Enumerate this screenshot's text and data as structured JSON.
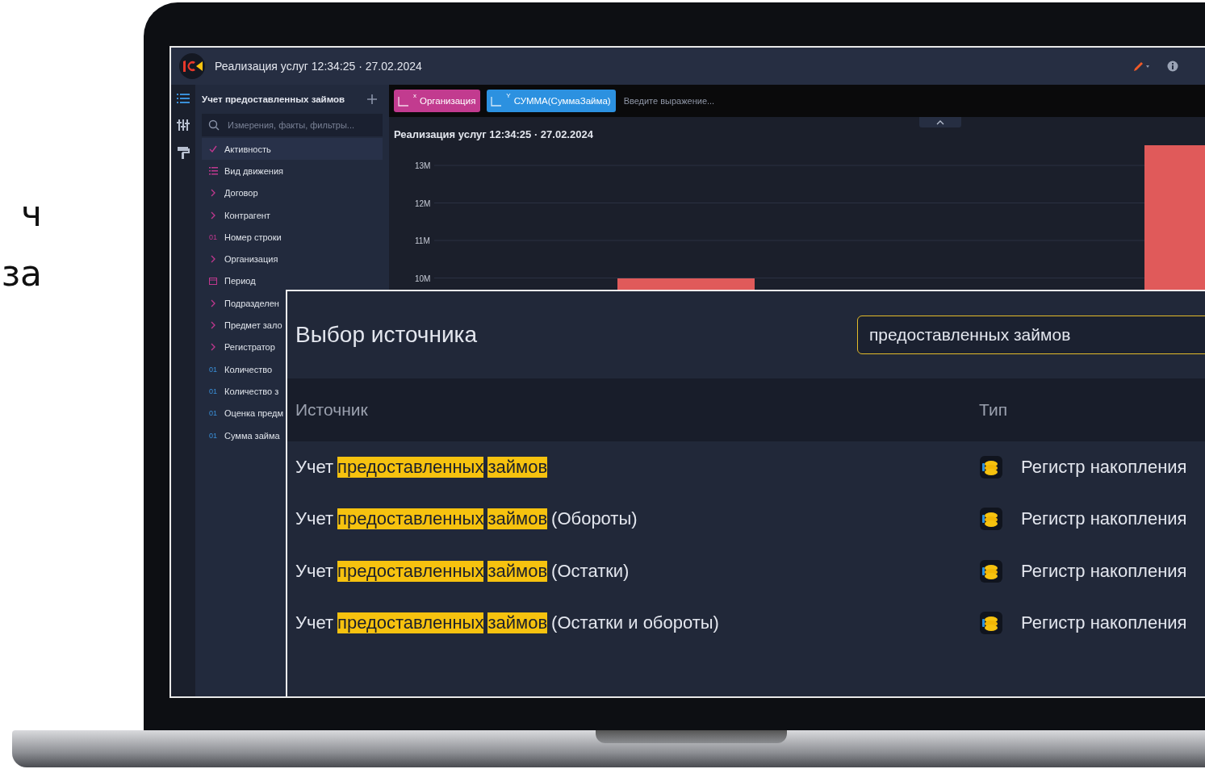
{
  "slide_fragments": [
    "ч",
    "за"
  ],
  "window": {
    "title": "Реализация услуг 12:34:25 · 27.02.2024"
  },
  "sidebar": {
    "title": "Учет предоставленных займов",
    "search": {
      "placeholder": "Измерения, факты, фильтры..."
    },
    "items": [
      {
        "label": "Активность",
        "kind": "check",
        "selected": true
      },
      {
        "label": "Вид движения",
        "kind": "list",
        "selected": false
      },
      {
        "label": "Договор",
        "kind": "dimension",
        "selected": false
      },
      {
        "label": "Контрагент",
        "kind": "dimension",
        "selected": false
      },
      {
        "label": "Номер строки",
        "kind": "number",
        "badge": "01",
        "selected": false
      },
      {
        "label": "Организация",
        "kind": "dimension",
        "selected": false
      },
      {
        "label": "Период",
        "kind": "date",
        "selected": false
      },
      {
        "label": "Подразделен",
        "kind": "dimension",
        "selected": false
      },
      {
        "label": "Предмет зало",
        "kind": "dimension",
        "selected": false
      },
      {
        "label": "Регистратор",
        "kind": "dimension",
        "selected": false
      },
      {
        "label": "Количество",
        "kind": "fact",
        "badge": "01",
        "selected": false
      },
      {
        "label": "Количество з",
        "kind": "fact",
        "badge": "01",
        "selected": false
      },
      {
        "label": "Оценка предм",
        "kind": "fact",
        "badge": "01",
        "selected": false
      },
      {
        "label": "Сумма займа",
        "kind": "fact",
        "badge": "01",
        "selected": false
      }
    ]
  },
  "toolbar": {
    "chips": [
      {
        "label": "Организация",
        "axis": "x",
        "kind": "dimension"
      },
      {
        "label": "СУММА(СуммаЗайма)",
        "axis": "Y",
        "kind": "fact"
      }
    ],
    "expression": {
      "placeholder": "Введите выражение..."
    }
  },
  "chart": {
    "title": "Реализация услуг 12:34:25 · 27.02.2024",
    "y_axis_labels": [
      "13M",
      "12M",
      "11M",
      "10M"
    ]
  },
  "dialog": {
    "title": "Выбор источника",
    "search": {
      "value": "предоставленных займов"
    },
    "columns": [
      "Источник",
      "Тип"
    ],
    "rows": [
      {
        "name": [
          {
            "text": "Учет",
            "highlight": false
          },
          {
            "text": "предоставленных",
            "highlight": true
          },
          {
            "text": "займов",
            "highlight": true
          }
        ],
        "type": "Регистр накопления"
      },
      {
        "name": [
          {
            "text": "Учет",
            "highlight": false
          },
          {
            "text": "предоставленных",
            "highlight": true
          },
          {
            "text": "займов",
            "highlight": true
          },
          {
            "text": "(Обороты)",
            "highlight": false
          }
        ],
        "type": "Регистр накопления"
      },
      {
        "name": [
          {
            "text": "Учет",
            "highlight": false
          },
          {
            "text": "предоставленных",
            "highlight": true
          },
          {
            "text": "займов",
            "highlight": true
          },
          {
            "text": "(Остатки)",
            "highlight": false
          }
        ],
        "type": "Регистр накопления"
      },
      {
        "name": [
          {
            "text": "Учет",
            "highlight": false
          },
          {
            "text": "предоставленных",
            "highlight": true
          },
          {
            "text": "займов",
            "highlight": true
          },
          {
            "text": "(Остатки и обороты)",
            "highlight": false
          }
        ],
        "type": "Регистр накопления"
      }
    ]
  }
}
